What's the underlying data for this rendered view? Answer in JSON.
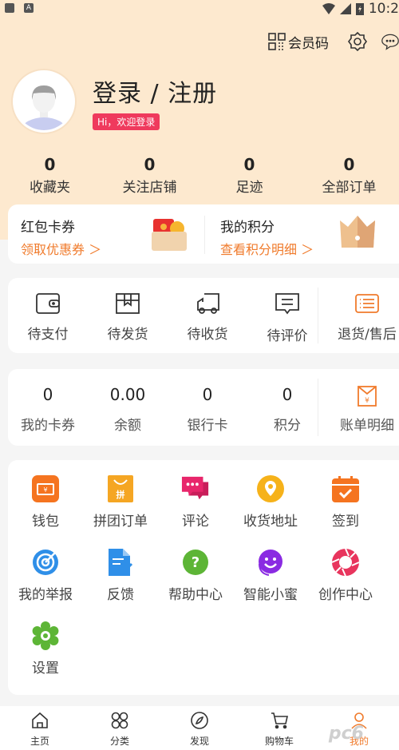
{
  "status_bar": {
    "time": "10:2"
  },
  "topbar": {
    "member_code_label": "会员码"
  },
  "profile": {
    "title": "登录 / 注册",
    "greeting_badge": "Hi，欢迎登录"
  },
  "stats": [
    {
      "value": "0",
      "label": "收藏夹"
    },
    {
      "value": "0",
      "label": "关注店铺"
    },
    {
      "value": "0",
      "label": "足迹"
    },
    {
      "value": "0",
      "label": "全部订单"
    }
  ],
  "coupons": {
    "left": {
      "title": "红包卡券",
      "link": "领取优惠券 ＞"
    },
    "right": {
      "title": "我的积分",
      "link": "查看积分明细 ＞"
    }
  },
  "orders": [
    {
      "label": "待支付",
      "icon": "wallet-outline-icon"
    },
    {
      "label": "待发货",
      "icon": "package-icon"
    },
    {
      "label": "待收货",
      "icon": "truck-icon"
    },
    {
      "label": "待评价",
      "icon": "comment-icon"
    },
    {
      "label": "退货/售后",
      "icon": "list-icon"
    }
  ],
  "wallet": [
    {
      "value": "0",
      "label": "我的卡券"
    },
    {
      "value": "0.00",
      "label": "余额"
    },
    {
      "value": "0",
      "label": "银行卡"
    },
    {
      "value": "0",
      "label": "积分"
    },
    {
      "label": "账单明细",
      "icon": "bill-icon"
    }
  ],
  "tools": [
    {
      "label": "钱包",
      "icon": "wallet-icon",
      "color": "#f57420"
    },
    {
      "label": "拼团订单",
      "icon": "group-buy-icon",
      "color": "#f5a623"
    },
    {
      "label": "评论",
      "icon": "chat-icon",
      "color": "#e8266b"
    },
    {
      "label": "收货地址",
      "icon": "location-icon",
      "color": "#f6b21a"
    },
    {
      "label": "签到",
      "icon": "calendar-check-icon",
      "color": "#f57420"
    },
    {
      "label": "我的举报",
      "icon": "target-icon",
      "color": "#2f8fe8"
    },
    {
      "label": "反馈",
      "icon": "document-edit-icon",
      "color": "#2f8fe8"
    },
    {
      "label": "帮助中心",
      "icon": "help-icon",
      "color": "#5db536"
    },
    {
      "label": "智能小蜜",
      "icon": "assistant-icon",
      "color": "#8a2be2"
    },
    {
      "label": "创作中心",
      "icon": "aperture-icon",
      "color": "#e8355d"
    },
    {
      "label": "设置",
      "icon": "settings-icon",
      "color": "#5db536"
    }
  ],
  "tabbar": [
    {
      "label": "主页"
    },
    {
      "label": "分类"
    },
    {
      "label": "发现"
    },
    {
      "label": "购物车"
    },
    {
      "label": "我的",
      "active": true
    }
  ],
  "watermark": "pc6"
}
